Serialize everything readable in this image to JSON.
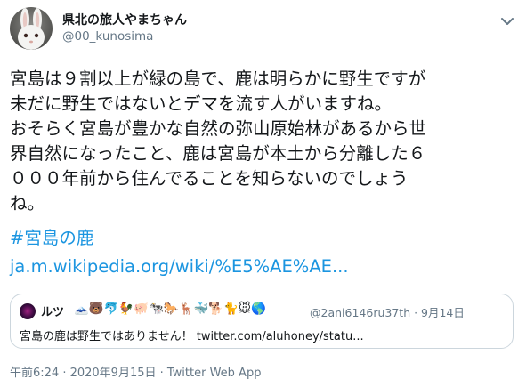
{
  "author": {
    "display_name": "県北の旅人やまちゃん",
    "handle": "@00_kunosima",
    "avatar_icon": "white-rabbit-avatar"
  },
  "tweet": {
    "lines": [
      "宮島は９割以上が緑の島で、鹿は明らかに野生ですが",
      "未だに野生ではないとデマを流す人がいますね。",
      "おそらく宮島が豊かな自然の弥山原始林があるから世",
      "界自然になったこと、鹿は宮島が本土から分離した６",
      "０００年前から住んでることを知らないのでしょう",
      "ね。"
    ],
    "hashtag": "#宮島の鹿",
    "url": "ja.m.wikipedia.org/wiki/%E5%AE%AE..."
  },
  "quoted": {
    "name": "ルツ",
    "emojis": "🗻🐻🐬🐓🐖🐄🐎🦌🐳🐕🐈🐭🌎",
    "meta": "@2ani6146ru37th · 9月14日",
    "text": "宮島の鹿は野生ではありません！ twitter.com/aluhoney/statu..."
  },
  "footer": {
    "meta": "午前6:24 · 2020年9月15日 · Twitter Web App"
  },
  "icons": {
    "more": "chevron-down-icon"
  },
  "colors": {
    "link": "#1b95e0",
    "text": "#14171a",
    "secondary": "#657786",
    "border": "#ccd6dd"
  }
}
